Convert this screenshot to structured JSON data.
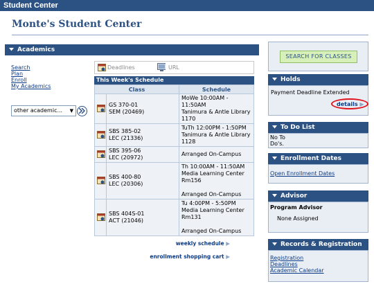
{
  "topbar": {
    "title": "Student Center"
  },
  "page": {
    "title": "Monte's Student Center"
  },
  "academics": {
    "header": "Academics",
    "links": [
      "Search",
      "Plan",
      "Enroll",
      "My Academics"
    ],
    "select_value": "other academic...",
    "tabs": {
      "deadlines": "Deadlines",
      "url": "URL"
    },
    "schedule_title": "This Week's Schedule",
    "columns": [
      "Class",
      "Schedule"
    ],
    "rows": [
      {
        "class": [
          "GS 370-01",
          "SEM (20469)"
        ],
        "schedule": [
          "MoWe 10:00AM -",
          "11:50AM",
          "Tanimura & Antle Library",
          "1170"
        ]
      },
      {
        "class": [
          "SBS 385-02",
          "LEC (21336)"
        ],
        "schedule": [
          "TuTh 12:00PM - 1:50PM",
          "Tanimura & Antle Library",
          "1128"
        ]
      },
      {
        "class": [
          "SBS 395-06",
          "LEC (20972)"
        ],
        "schedule": [
          "Arranged On-Campus"
        ]
      },
      {
        "class": [
          "SBS 400-80",
          "LEC (20306)"
        ],
        "schedule": [
          "Th 10:00AM - 11:50AM",
          "Media Learning Center",
          "Rm156",
          "",
          "Arranged On-Campus"
        ]
      },
      {
        "class": [
          "SBS 404S-01",
          "ACT (21046)"
        ],
        "schedule": [
          "Tu 4:00PM - 5:50PM",
          "Media Learning Center",
          "Rm131",
          "",
          "Arranged On-Campus"
        ]
      }
    ],
    "weekly_link": "weekly schedule",
    "cart_link": "enrollment shopping cart"
  },
  "right": {
    "search_button": "SEARCH FOR CLASSES",
    "holds": {
      "header": "Holds",
      "item": "Payment Deadline Extended",
      "details": "details"
    },
    "todo": {
      "header": "To Do List",
      "text": [
        "No To",
        "Do's."
      ]
    },
    "enrollment_dates": {
      "header": "Enrollment Dates",
      "link": "Open Enrollment Dates"
    },
    "advisor": {
      "header": "Advisor",
      "label": "Program Advisor",
      "value": "None Assigned"
    },
    "records": {
      "header": "Records & Registration",
      "links": [
        "Registration",
        "Deadlines",
        "Academic Calendar"
      ]
    }
  },
  "colors": {
    "header_blue": "#2c5284",
    "search_green": "#d7efb8",
    "highlight_red": "#e1121c"
  }
}
